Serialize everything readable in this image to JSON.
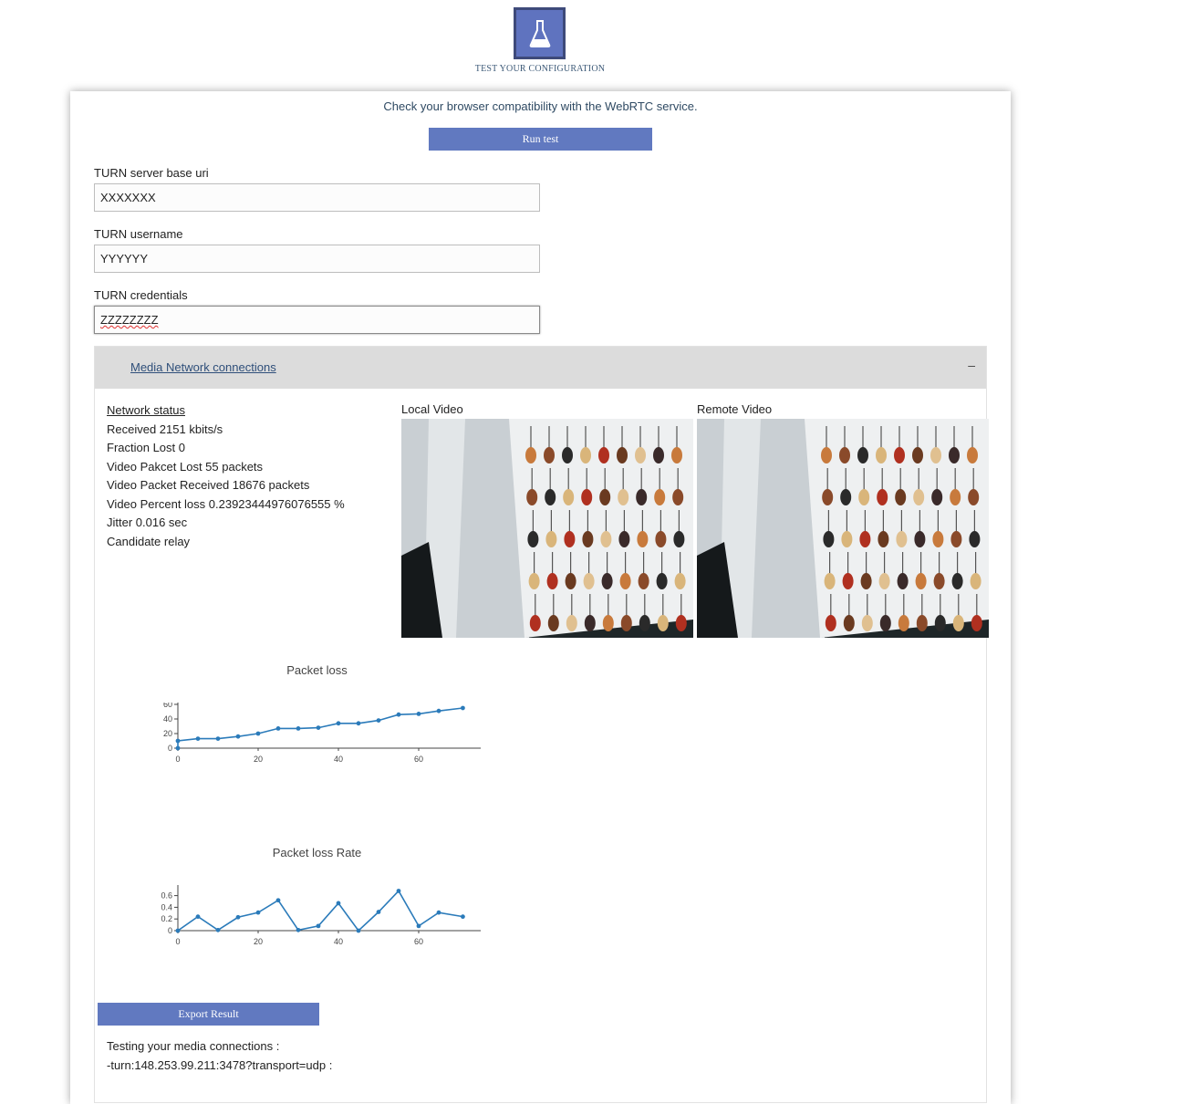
{
  "header": {
    "logo_icon": "flask-icon",
    "caption": "TEST YOUR CONFIGURATION"
  },
  "intro_text": "Check your browser compatibility with the WebRTC service.",
  "run_button": "Run test",
  "fields": {
    "turn_uri": {
      "label": "TURN server base uri",
      "value": "XXXXXXX"
    },
    "turn_username": {
      "label": "TURN username",
      "value": "YYYYYY"
    },
    "turn_credentials": {
      "label": "TURN credentials",
      "value": "ZZZZZZZZ"
    }
  },
  "accordion": {
    "title": "Media Network connections",
    "toggle": "–"
  },
  "network_status": {
    "title": "Network status",
    "lines": [
      "Received 2151 kbits/s",
      "Fraction Lost 0",
      "Video Pakcet Lost 55 packets",
      "Video Packet Received 18676 packets",
      "Video Percent loss 0.23923444976076555 %",
      "Jitter 0.016 sec",
      "Candidate relay"
    ]
  },
  "videos": {
    "local_label": "Local Video",
    "remote_label": "Remote Video"
  },
  "chart_data": [
    {
      "type": "line",
      "title": "Packet loss",
      "x": [
        0,
        0,
        5,
        10,
        15,
        20,
        25,
        30,
        35,
        40,
        45,
        50,
        55,
        60,
        65,
        71
      ],
      "y": [
        0,
        10,
        13,
        13,
        16,
        20,
        27,
        27,
        28,
        34,
        34,
        38,
        46,
        47,
        51,
        55
      ],
      "xticks": [
        0,
        20,
        40,
        60
      ],
      "yticks": [
        0,
        20,
        40,
        60
      ],
      "xlim": [
        0,
        75
      ],
      "ylim": [
        0,
        60
      ],
      "color": "#2b7bba"
    },
    {
      "type": "line",
      "title": "Packet loss Rate",
      "x": [
        0,
        5,
        10,
        15,
        20,
        25,
        30,
        35,
        40,
        45,
        50,
        55,
        60,
        65,
        71
      ],
      "y": [
        0,
        0.24,
        0.01,
        0.23,
        0.31,
        0.52,
        0.01,
        0.08,
        0.47,
        0.0,
        0.32,
        0.68,
        0.08,
        0.31,
        0.24
      ],
      "xticks": [
        0,
        20,
        40,
        60
      ],
      "yticks": [
        0,
        0.2,
        0.4,
        0.6
      ],
      "ytick_labels": [
        "0",
        "0.2",
        "0.4",
        "0.6"
      ],
      "xlim": [
        0,
        75
      ],
      "ylim": [
        0,
        0.75
      ],
      "color": "#2b7bba"
    }
  ],
  "export_button": "Export Result",
  "log_lines": [
    "Testing your media connections :",
    "-turn:148.253.99.211:3478?transport=udp :"
  ]
}
